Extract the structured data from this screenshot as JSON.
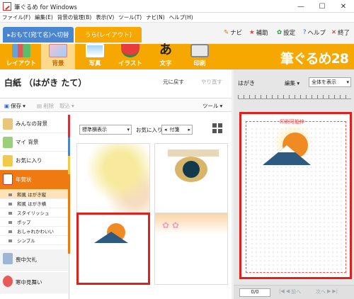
{
  "window": {
    "title": "筆ぐるめ for Windows",
    "min": "—",
    "max": "☐",
    "close": "✕"
  },
  "menu": [
    "ファイル(F)",
    "編集(E)",
    "背景の管理(B)",
    "表示(V)",
    "ツール(T)",
    "ナビ(N)",
    "ヘルプ(H)"
  ],
  "tabs": {
    "front": "▸おもて(宛て名)へ切替",
    "back": "うら(レイアウト)"
  },
  "toplinks": {
    "navi": "ナビ",
    "hojo": "補助",
    "settings": "設定",
    "help": "ヘルプ",
    "exit": "終了"
  },
  "ribbon": {
    "items": [
      "レイアウト",
      "背景",
      "写真",
      "イラスト",
      "文字",
      "印刷"
    ],
    "brand": "筆ぐるめ28",
    "accent": "#f6a800"
  },
  "left": {
    "title": "白紙 （はがき たて）",
    "undo": "元に戻す",
    "redo": "やり直す",
    "toolbar": {
      "save": "保存",
      "delete": "削除",
      "load": "取込",
      "tools": "ツール"
    },
    "categories": [
      "みんなの背景",
      "マイ 背景",
      "お気に入り",
      "年賀状"
    ],
    "subcategories": [
      "和風 はがき縦",
      "和風 はがき横",
      "スタイリッシュ",
      "ポップ",
      "おしゃれかわいい",
      "シンプル"
    ],
    "more": [
      "喪中欠礼",
      "寒中見舞い"
    ],
    "view_select": "標準横表示",
    "favorite": "お気に入り",
    "attach": "付箋"
  },
  "right": {
    "label": "はがき",
    "edit": "編集",
    "zoom": "全体を表示",
    "print_area": "印刷可能枠",
    "page": "0/0",
    "prev": "前へ",
    "next": "次へ"
  }
}
